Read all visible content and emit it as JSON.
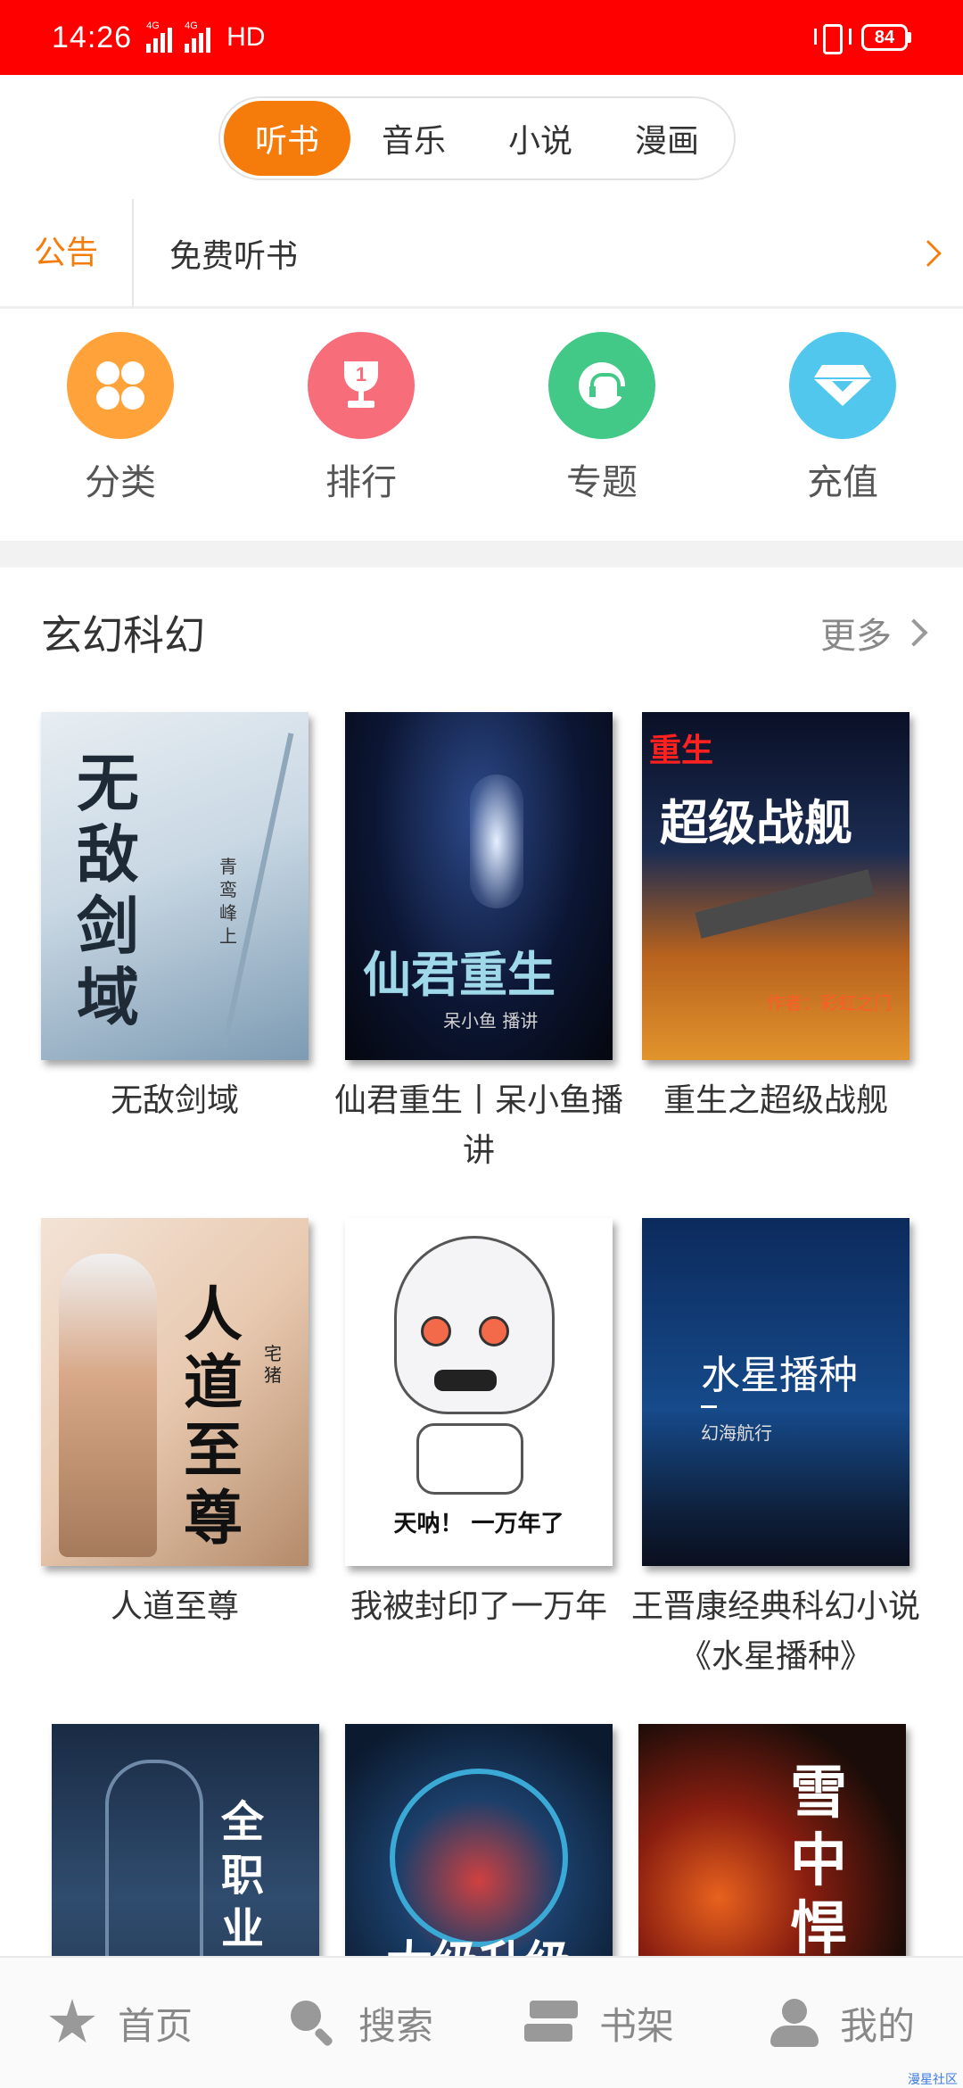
{
  "status_bar": {
    "time": "14:26",
    "signal_1": "4G",
    "signal_2": "4G",
    "hd": "HD",
    "battery": "84"
  },
  "tabs": [
    {
      "label": "听书",
      "active": true
    },
    {
      "label": "音乐",
      "active": false
    },
    {
      "label": "小说",
      "active": false
    },
    {
      "label": "漫画",
      "active": false
    }
  ],
  "notice": {
    "label": "公告",
    "text": "免费听书"
  },
  "entries": [
    {
      "label": "分类",
      "icon": "clover-icon",
      "color": "#ffa23a"
    },
    {
      "label": "排行",
      "icon": "trophy-icon",
      "color": "#f76d7a"
    },
    {
      "label": "专题",
      "icon": "headphones-icon",
      "color": "#42c987"
    },
    {
      "label": "充值",
      "icon": "diamond-icon",
      "color": "#52c7ee"
    }
  ],
  "section": {
    "title": "玄幻科幻",
    "more": "更多"
  },
  "books": [
    {
      "title": "无敌剑域",
      "cover_title": "无敌剑域",
      "cover_sub": "青鸾峰上"
    },
    {
      "title": "仙君重生丨呆小鱼播讲",
      "cover_title": "仙君重生",
      "cover_sub": "呆小鱼 播讲"
    },
    {
      "title": "重生之超级战舰",
      "cover_title": "超级战舰",
      "cover_badge": "重生",
      "cover_sub": "作者：彩虹之门"
    },
    {
      "title": "人道至尊",
      "cover_title": "人道至尊",
      "cover_sub": "宅猪"
    },
    {
      "title": "我被封印了一万年",
      "cover_title": "天呐！ 一万年了"
    },
    {
      "title": "王晋康经典科幻小说《水星播种》",
      "cover_title": "水星播种",
      "cover_sub": "幻海航行"
    },
    {
      "title": "",
      "cover_title": "全职业"
    },
    {
      "title": "",
      "cover_title": "大级升级"
    },
    {
      "title": "",
      "cover_title": "雪中悍刀"
    }
  ],
  "bottom_nav": [
    {
      "label": "首页",
      "icon": "star-icon"
    },
    {
      "label": "搜索",
      "icon": "search-icon"
    },
    {
      "label": "书架",
      "icon": "bookshelf-icon"
    },
    {
      "label": "我的",
      "icon": "profile-icon"
    }
  ],
  "watermark": "漫星社区"
}
